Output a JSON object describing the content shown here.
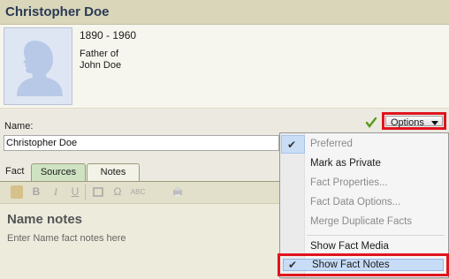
{
  "header": {
    "title": "Christopher Doe"
  },
  "person": {
    "dates": "1890 - 1960",
    "relation_line1": "Father of",
    "relation_line2": "John Doe"
  },
  "name_field": {
    "label": "Name:",
    "value": "Christopher Doe"
  },
  "options_button": {
    "label": "Options"
  },
  "tabs": {
    "fact_label": "Fact",
    "sources": "Sources",
    "notes": "Notes"
  },
  "editor": {
    "toolbar_icons": [
      "lock-icon",
      "bold-icon",
      "italic-icon",
      "underline-icon",
      "clear-format-icon",
      "special-char-icon",
      "spellcheck-icon",
      "print-icon"
    ],
    "bold_glyph": "B",
    "italic_glyph": "I",
    "underline_glyph": "U",
    "omega_glyph": "Ω",
    "spell_glyph": "ABC",
    "title": "Name notes",
    "hint": "Enter Name fact notes here"
  },
  "menu": {
    "check_glyph": "✔",
    "items": [
      {
        "label": "Preferred",
        "disabled": true,
        "checked": true
      },
      {
        "label": "Mark as Private",
        "disabled": false,
        "checked": false
      },
      {
        "label": "Fact Properties...",
        "disabled": true,
        "checked": false
      },
      {
        "label": "Fact Data Options...",
        "disabled": true,
        "checked": false
      },
      {
        "label": "Merge Duplicate Facts",
        "disabled": true,
        "checked": false
      },
      {
        "label": "Show Fact Media",
        "disabled": false,
        "checked": false
      },
      {
        "label": "Show Fact Notes",
        "disabled": false,
        "checked": true
      }
    ]
  },
  "colors": {
    "header_bg": "#d9d6ba",
    "title_text": "#2b3a55",
    "highlight_red": "#e0141e",
    "menu_selected": "#c9ddf5",
    "check_green": "#5a9a1a"
  }
}
